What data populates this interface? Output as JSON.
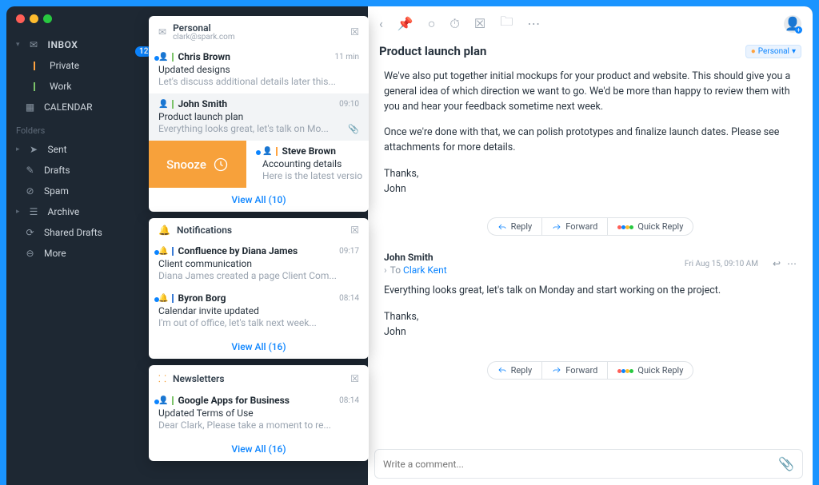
{
  "sidebar": {
    "inbox": "INBOX",
    "badge": "12",
    "private": "Private",
    "work": "Work",
    "calendar": "CALENDAR",
    "folders_label": "Folders",
    "folders": [
      "Sent",
      "Drafts",
      "Spam",
      "Archive",
      "Shared Drafts",
      "More"
    ]
  },
  "personal": {
    "title": "Personal",
    "email": "clark@spark.com",
    "messages": [
      {
        "sender": "Chris Brown",
        "time": "11 min",
        "subject": "Updated designs",
        "preview": "Let's discuss additional details later this...",
        "bar": "g"
      },
      {
        "sender": "John Smith",
        "time": "09:10",
        "subject": "Product launch plan",
        "preview": "Everything looks great, let's talk on Mo...",
        "bar": "g",
        "attach": true,
        "active": true
      },
      {
        "sender": "Steve Brown",
        "time": "",
        "subject": "Accounting details",
        "preview": "Here is the latest versio",
        "bar": "o",
        "snooze": true
      }
    ],
    "snooze_label": "Snooze",
    "viewall": "View All (10)"
  },
  "notifications": {
    "title": "Notifications",
    "messages": [
      {
        "sender": "Confluence by Diana James",
        "time": "09:17",
        "subject": "Client communication",
        "preview": "Diana James created a page Client Com...",
        "bar": "b",
        "bell": true
      },
      {
        "sender": "Byron Borg",
        "time": "08:14",
        "subject": "Calendar invite updated",
        "preview": "I'm out of office, let's talk next week...",
        "bar": "b",
        "bell": true
      }
    ],
    "viewall": "View All (16)"
  },
  "newsletters": {
    "title": "Newsletters",
    "messages": [
      {
        "sender": "Google Apps for Business",
        "time": "08:14",
        "subject": "Updated Terms of Use",
        "preview": "Dear Clark, Please take a moment to re...",
        "bar": "g"
      }
    ],
    "viewall": "View All (16)"
  },
  "reader": {
    "title": "Product launch plan",
    "tag": "Personal",
    "b1": "We've also put together initial mockups for your product and website. This should give you a general idea of which direction we want to go. We'd be more than happy to review them with you and hear your feedback sometime next week.",
    "b2": "Once we're done with that, we can polish prototypes and finalize launch dates. Please see attachments for more details.",
    "b3": "Thanks,",
    "b4": "John",
    "reply": "Reply",
    "forward": "Forward",
    "quick": "Quick Reply",
    "thread_sender": "John Smith",
    "thread_to_label": "To",
    "thread_to": "Clark Kent",
    "thread_date": "Fri Aug 15, 09:10 AM",
    "t1": "Everything looks great, let's talk on Monday and start working on the project.",
    "t2": "Thanks,",
    "t3": "John",
    "comment_ph": "Write a comment..."
  }
}
